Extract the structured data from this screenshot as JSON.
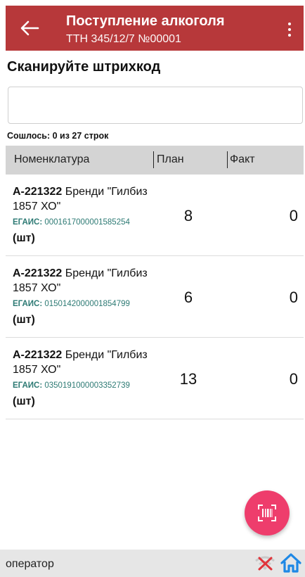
{
  "appbar": {
    "title": "Поступление алкоголя",
    "subtitle": "ТТН 345/12/7 №00001",
    "color": "#b7383a",
    "back_icon": "arrow-back-icon",
    "menu_icon": "more-vert-icon"
  },
  "scan": {
    "heading": "Сканируйте штрихкод",
    "value": "",
    "placeholder": ""
  },
  "status": {
    "matched": "Сошлось: 0 из 27 строк"
  },
  "table": {
    "columns": [
      "Номенклатура",
      "План",
      "Факт"
    ],
    "rows": [
      {
        "article": "А-221322",
        "name": " Бренди \"Гилбиз 1857 ХО\"",
        "egais_label": "ЕГАИС:",
        "egais_code": " 0001617000001585254",
        "unit": "(шт)",
        "plan": "8",
        "fact": "0"
      },
      {
        "article": "А-221322",
        "name": " Бренди \"Гилбиз 1857 ХО\"",
        "egais_label": "ЕГАИС:",
        "egais_code": " 0150142000001854799",
        "unit": "(шт)",
        "plan": "6",
        "fact": "0"
      },
      {
        "article": "А-221322",
        "name": " Бренди \"Гилбиз 1857 ХО\"",
        "egais_label": "ЕГАИС:",
        "egais_code": " 0350191000003352739",
        "unit": "(шт)",
        "plan": "13",
        "fact": "0"
      }
    ]
  },
  "fab": {
    "icon": "barcode-scan-icon",
    "color": "#ee3d6c"
  },
  "bottom": {
    "user": "оператор",
    "wifi_icon": "wifi-off-icon",
    "home_icon": "home-icon",
    "home_color": "#1e88e5"
  }
}
